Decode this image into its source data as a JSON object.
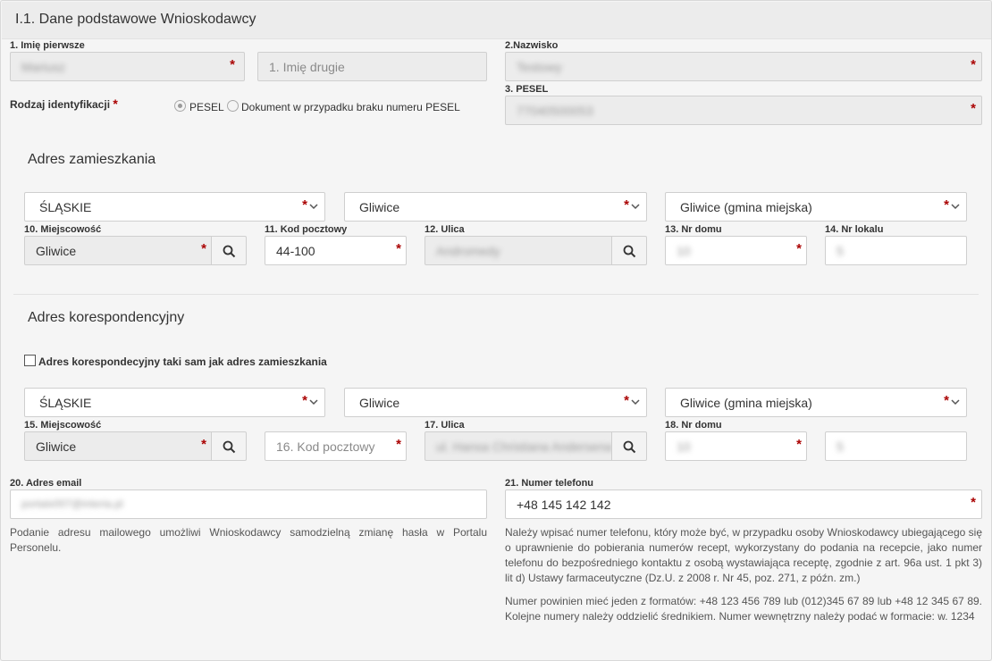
{
  "panel": {
    "title": "I.1. Dane podstawowe Wnioskodawcy"
  },
  "colors": {
    "required": "#aa0000",
    "readonly_bg": "#ececec",
    "border": "#cfcfcf"
  },
  "applicant": {
    "first_name_label": "1. Imię pierwsze",
    "first_name_value": "Mariusz",
    "second_name_placeholder": "1. Imię drugie",
    "surname_label": "2.Nazwisko",
    "surname_value": "Testowy",
    "pesel_label": "3. PESEL",
    "pesel_value": "77040500053",
    "id_type_label": "Rodzaj identyfikacji",
    "id_type_options": [
      "PESEL",
      "Dokument w przypadku braku numeru PESEL"
    ],
    "id_type_selected": "PESEL"
  },
  "residence": {
    "section_title": "Adres zamieszkania",
    "voivodeship": "ŚLĄSKIE",
    "county": "Gliwice",
    "municipality": "Gliwice (gmina miejska)",
    "city_label": "10. Miejscowość",
    "city_value": "Gliwice",
    "postal_label": "11. Kod pocztowy",
    "postal_value": "44-100",
    "street_label": "12. Ulica",
    "street_value": "Andromedy",
    "house_label": "13. Nr domu",
    "house_value": "10",
    "flat_label": "14. Nr lokalu",
    "flat_value": "5"
  },
  "correspondence": {
    "section_title": "Adres korespondencyjny",
    "same_as_label": "Adres korespondecyjny taki sam jak adres zamieszkania",
    "voivodeship": "ŚLĄSKIE",
    "county": "Gliwice",
    "municipality": "Gliwice (gmina miejska)",
    "city_label": "15. Miejscowość",
    "city_value": "Gliwice",
    "postal_placeholder": "16. Kod pocztowy",
    "street_label": "17. Ulica",
    "street_value": "ul. Hansa Christiana Andersena",
    "house_label": "18. Nr domu",
    "house_value": "10",
    "flat_value": "5"
  },
  "contact": {
    "email_label": "20. Adres email",
    "email_value": "portalx007@interia.pl",
    "email_help": "Podanie adresu mailowego umożliwi Wnioskodawcy samodzielną zmianę hasła w Portalu Personelu.",
    "phone_label": "21. Numer telefonu",
    "phone_value": "+48 145 142 142",
    "phone_help_1": "Należy wpisać numer telefonu, który może być, w przypadku osoby Wnioskodawcy ubiegającego się o uprawnienie do pobierania numerów recept, wykorzystany do podania na recepcie, jako numer telefonu do bezpośredniego kontaktu z osobą wystawiająca receptę, zgodnie z art. 96a ust. 1 pkt 3) lit d) Ustawy farmaceutyczne (Dz.U. z 2008 r. Nr 45, poz. 271, z późn. zm.)",
    "phone_help_2": "Numer powinien mieć jeden z formatów: +48 123 456 789 lub (012)345 67 89 lub +48 12 345 67 89. Kolejne numery należy oddzielić średnikiem. Numer wewnętrzny należy podać w formacie: w. 1234"
  },
  "icons": {
    "search": "search-icon",
    "chevron": "chevron-down-icon"
  }
}
